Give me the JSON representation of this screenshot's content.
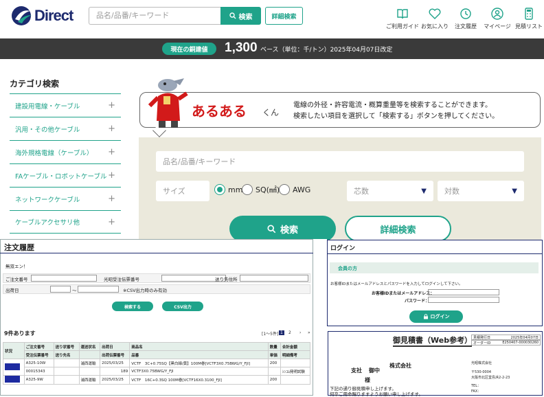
{
  "header": {
    "logo_text": "Direct",
    "search_placeholder": "品名/品番/キーワード",
    "search_button": "検索",
    "advanced_button": "詳細検索",
    "nav": [
      {
        "label": "ご利用ガイド",
        "icon": "book-icon"
      },
      {
        "label": "お気に入り",
        "icon": "heart-icon"
      },
      {
        "label": "注文履歴",
        "icon": "history-icon"
      },
      {
        "label": "マイページ",
        "icon": "user-icon"
      },
      {
        "label": "見積リスト",
        "icon": "calculator-icon"
      }
    ]
  },
  "price_band": {
    "badge": "現在の銅建値",
    "price": "1,300",
    "note": "ベース（単位：千/トン）2025年04月07日改定"
  },
  "sidebar": {
    "title": "カテゴリ検索",
    "items": [
      "建設用電線・ケーブル",
      "汎用・その他ケーブル",
      "海外規格電線（ケーブル）",
      "FAケーブル・ロボットケーブル",
      "ネットワークケーブル",
      "ケーブルアクセサリ他"
    ],
    "expand_glyph": "+"
  },
  "hero": {
    "name": "あるある",
    "suffix": "くん",
    "description_1": "電線の外径・許容電流・概算重量等を検索することができます。",
    "description_2": "検索したい項目を選択して「検索する」ボタンを押してください。"
  },
  "search_panel": {
    "keyword_placeholder": "品名/品番/キーワード",
    "size_placeholder": "サイズ",
    "units": [
      "mm",
      "SQ(㎟)",
      "AWG"
    ],
    "selected_unit": "mm",
    "core_select": "芯数",
    "pair_select": "対数",
    "search_button": "検索",
    "advanced_button": "詳細検索"
  },
  "order_history": {
    "title": "注文履歴",
    "tag": "無双エン！",
    "labels": {
      "order_no": "ご注文番号",
      "slip_no": "光昭受注伝票番号",
      "ship_to": "送り先住所",
      "ship_date": "出荷日",
      "csv_note": "※CSV出力時のみ有効",
      "tilde": "〜"
    },
    "search_btn": "検索する",
    "csv_btn": "CSV出力",
    "count": "9件あります",
    "range": "[1〜5件]",
    "pages": [
      "1",
      "2",
      "›",
      "»"
    ],
    "columns_top": [
      "状況",
      "ご注文番号",
      "送り状番号",
      "運送状名",
      "出荷日",
      "商品名",
      "数量",
      "合計金額"
    ],
    "columns_bottom": [
      "受注伝票番号",
      "送り先名",
      "出荷伝票番号",
      "品番",
      "単価",
      "明細備考"
    ],
    "rows": [
      [
        "A325-10W",
        "",
        "浦西運輸",
        "2025/03/25",
        "VCTF　3C+0.75SQ【黒白緑/黄】100M巻[VCTF3X0.75BWG/Y_FJI]",
        "200",
        ""
      ],
      [
        "00015343",
        "",
        "",
        "189",
        "VCTF3X0.75BWG/Y_FJI",
        "",
        "ｼﾝｺﾑ発明試験"
      ],
      [
        "A325-9W",
        "",
        "浦西運輸",
        "2025/03/25",
        "VCTF　16C+0.3SQ 100M巻[VCTF16X0.3100_FJI]",
        "200",
        ""
      ]
    ]
  },
  "login": {
    "title": "ログイン",
    "member_label": "会員の方",
    "instructions": "お客様IDまたはメールアドレスとパスワードを入力してログインして下さい。",
    "id_label": "お客様IDまたはメールアドレス：",
    "pw_label": "パスワード：",
    "button": "ログイン"
  },
  "quote": {
    "title": "御見積書（Web参考）",
    "issue_label": "見積発行日",
    "issue_date": "2025年04月07日",
    "order_label": "オーダーID",
    "order_id": "E250407-000030260",
    "branch": "支社",
    "honorific": "御中",
    "company": "株式会社",
    "sama": "様",
    "supplier": "光昭株式会社",
    "zip": "〒530-0004",
    "address": "大阪市北区堂島浜2-2-23",
    "tel": "TEL：",
    "fax": "FAX：",
    "note1": "下記の通り御見積申し上げます。",
    "note2": "何卒ご用命賜りますようお願い申し上げます。"
  }
}
